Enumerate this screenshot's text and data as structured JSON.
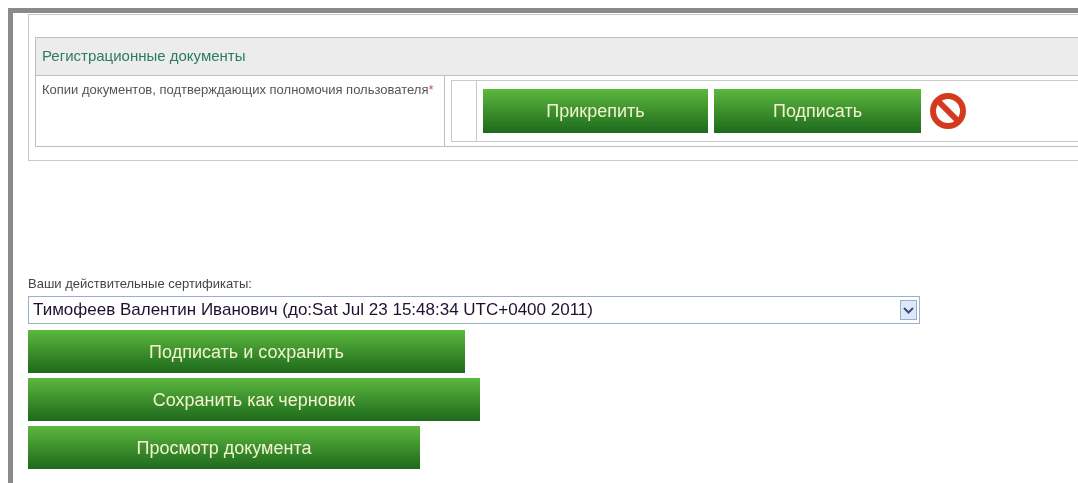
{
  "documents_section": {
    "title": "Регистрационные документы",
    "rows": [
      {
        "label": "Копии документов, подтверждающих полномочия пользователя",
        "required_mark": "*",
        "buttons": [
          "Прикрепить",
          "Подписать"
        ]
      }
    ]
  },
  "certificates": {
    "label": "Ваши действительные сертификаты:",
    "value": "Тимофеев Валентин Иванович (до:Sat Jul 23 15:48:34 UTC+0400 2011)"
  },
  "actions": [
    "Подписать и сохранить",
    "Сохранить как черновик",
    "Просмотр документа"
  ]
}
